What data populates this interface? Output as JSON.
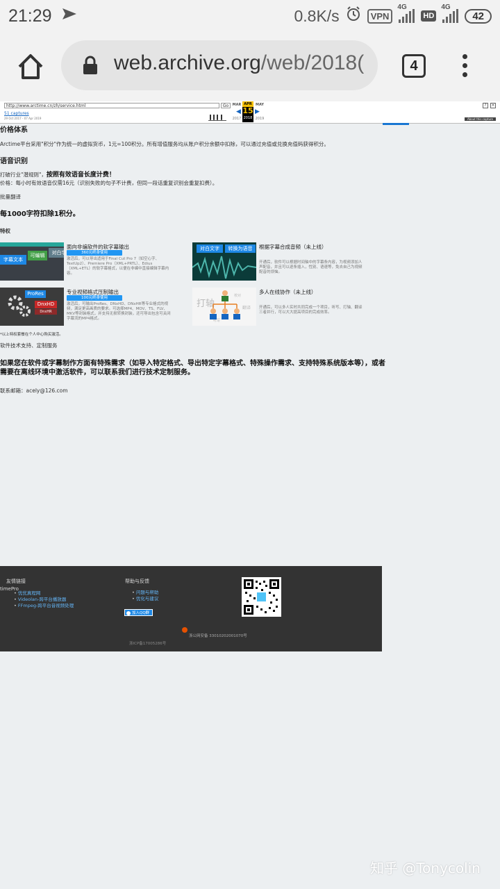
{
  "status_bar": {
    "time": "21:29",
    "net_speed": "0.8K/s",
    "vpn": "VPN",
    "signal1_label": "4G",
    "hd": "HD",
    "signal2_label": "4G",
    "battery": "42"
  },
  "browser": {
    "url_host": "web.archive.org",
    "url_path": "/web/2018(",
    "tab_count": "4"
  },
  "wayback": {
    "url_value": "http://www.arctime.cn/zh/service.html",
    "go_label": "Go",
    "captures": "51 captures",
    "range": "29 Oct 2017 - 07 Apr 2019",
    "month_prev": "MAR",
    "month_cur": "APR",
    "month_next": "MAY",
    "day": "15",
    "year_prev": "2017",
    "year_cur": "2018",
    "year_next": "2019",
    "about": "About this capture"
  },
  "content": {
    "pricing_title": "价格体系",
    "pricing_text": "Arctime平台采用\"积分\"作为统一的虚拟货币，1元=100积分。所有增值服务均从账户积分余额中扣除，可以通过充值或兑换充值码获得积分。",
    "speech_title": "语音识别",
    "speech_line1_a": "打破行业\"潜规则\"，",
    "speech_line1_b": "按照有效语音长度计费！",
    "speech_line2": "价格：每小时有效语音仅需16元（识别失败的句子不计费，但同一段话重复识别会重复扣费）。",
    "batch_label": "批量翻译",
    "batch_price": "每1000字符扣除1积分。",
    "privilege_label": "特权",
    "features": [
      {
        "title": "面向非编软件的软字幕输出",
        "tag": "360元终身使用",
        "desc": "激活后，可以导出适用于Final Cut Pro 7（如空心字、TextUp2）、Premiere Pro（XML+PRTL）、Edius（XML+ETL）的软字幕格式，以便在非编中直接编辑字幕内容。",
        "img_words": [
          "字幕文本",
          "可编辑",
          "对白字"
        ]
      },
      {
        "title": "根据字幕合成音频（未上线）",
        "tag": "",
        "desc": "开通后，软件可以根据时间轴中的字幕条内容，为视频添加人声配音，并且可以逐条插入，性别、语速等，免去自己为视频配音的烦恼。",
        "img_words": [
          "对白文字",
          "转换为语音"
        ]
      },
      {
        "title": "专业视频格式压制输出",
        "tag": "100元终身使用",
        "desc": "激活后，可输出ProRes、DNxHD、DNxHR等专业格式的视频，满足更高画质的要求。可选择MP4、MOV、TS、FLV、MKV等封装格式，并支持无损转换封装，还可导出包含可关闭字幕流的MP4格式。",
        "img_words": [
          "ProRes",
          "DnxHD",
          "DnxHR"
        ]
      },
      {
        "title": "多人在线协作（未上线）",
        "tag": "",
        "desc": "开通后，可以多人实时共同完成一个项目，听写、打轴、翻译三者并行，可以大大提高项目的完成效率。",
        "img_words": [
          "打轴",
          "听写",
          "翻译",
          "校对"
        ]
      }
    ],
    "personal_note": "*以上特权套餐在个人中心购买激活。",
    "custom_label": "软件技术支持、定制服务",
    "custom_text": "如果您在软件或字幕制作方面有特殊需求（如导入特定格式、导出特定字幕格式、特殊操作需求、支持特殊系统版本等），或者需要在离线环境中激活软件，可以联系我们进行技术定制服务。",
    "contact": "联系邮箱：acely@126.com"
  },
  "footer": {
    "links_title": "友情链接",
    "links_prefix": "timePro",
    "links": [
      "优优真程网",
      "Videolan-跨平台播放器",
      "FFmpeg-跨平台音视频处理"
    ],
    "help_title": "帮助与反馈",
    "help_links": [
      "问题与帮助",
      "优化与建议"
    ],
    "qq_button": "加入QQ群",
    "icp": "浙ICP备17005286号",
    "police": "浙公网安备 33010202001070号"
  },
  "watermark": "知乎 @Tonycolin"
}
